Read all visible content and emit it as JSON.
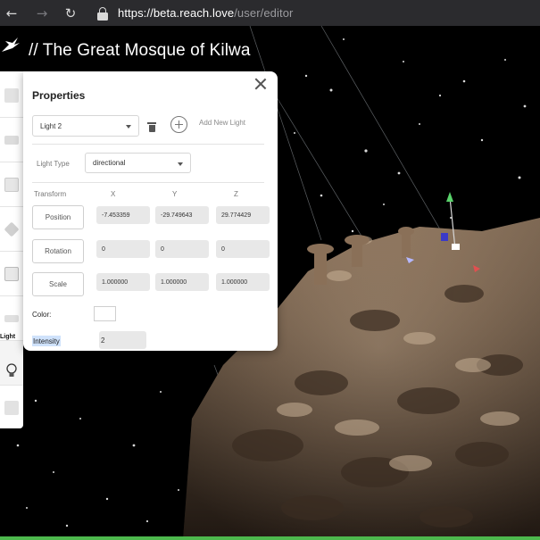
{
  "browser": {
    "url_host": "https://beta.reach.love",
    "url_path": "/user/editor"
  },
  "app": {
    "title": "// The Great Mosque of Kilwa"
  },
  "toolbar": {
    "active_label": "Light",
    "tools": [
      "image-icon",
      "chart-icon",
      "text-icon",
      "satellite-icon",
      "box-icon",
      "terrain-icon",
      "light-icon",
      "marker-icon"
    ]
  },
  "panel": {
    "title": "Properties",
    "light_select": "Light 2",
    "add_new_light": "Add New Light",
    "light_type_label": "Light Type",
    "light_type_value": "directional",
    "transform_label": "Transform",
    "axis": {
      "x": "X",
      "y": "Y",
      "z": "Z"
    },
    "position": {
      "label": "Position",
      "x": "-7.453359",
      "y": "-29.749643",
      "z": "29.774429"
    },
    "rotation": {
      "label": "Rotation",
      "x": "0",
      "y": "0",
      "z": "0"
    },
    "scale": {
      "label": "Scale",
      "x": "1.000000",
      "y": "1.000000",
      "z": "1.000000"
    },
    "color_label": "Color:",
    "color_value": "#ffffff",
    "intensity_label": "Intensity",
    "intensity_value": "2"
  }
}
